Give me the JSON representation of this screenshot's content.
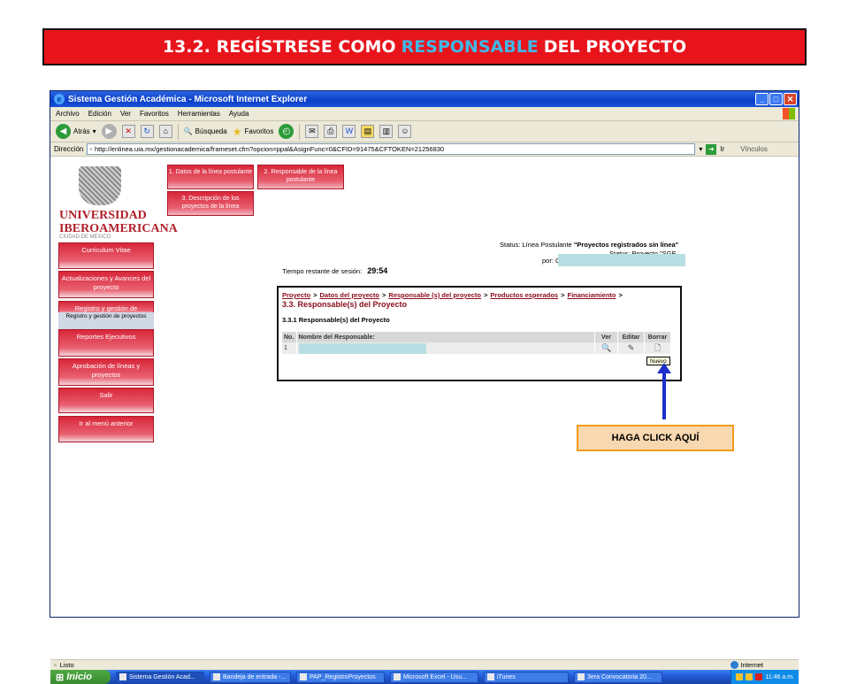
{
  "banner": {
    "prefix": "13.2. REGÍSTRESE COMO",
    "highlight": "RESPONSABLE",
    "suffix": "DEL PROYECTO"
  },
  "window": {
    "title": "Sistema Gestión Académica - Microsoft Internet Explorer",
    "menu": [
      "Archivo",
      "Edición",
      "Ver",
      "Favoritos",
      "Herramientas",
      "Ayuda"
    ],
    "toolbar": {
      "back": "Atrás",
      "search": "Búsqueda",
      "favorites": "Favoritos"
    },
    "address_label": "Dirección",
    "url": "http://enlinea.uia.mx/gestionacademica/frameset.cfm?opcion=ppal&AsignFunc=0&CFID=91475&CFTOKEN=21256830",
    "go_label": "Ir",
    "links_label": "Vínculos",
    "status_left": "Listo",
    "status_zone": "Internet"
  },
  "logo": {
    "line1": "UNIVERSIDAD",
    "line2": "IBEROAMERICANA",
    "line3": "CIUDAD DE MÉXICO"
  },
  "sidebar": [
    {
      "label": "Curriculum Vitae"
    },
    {
      "label": "Actualizaciones y Avances del proyecto"
    },
    {
      "label": "Registro y gestión de"
    },
    {
      "label": "Reportes Ejecutivos"
    },
    {
      "label": "Aprobación de líneas y proyectos"
    },
    {
      "label": "Salir"
    },
    {
      "label": "Ir al menú anterior"
    }
  ],
  "sidebar_submenu": "Registro y gestión de proyectos",
  "top_buttons": [
    {
      "label": "1. Datos de la línea postulante"
    },
    {
      "label": "2. Responsable de la línea postulante"
    },
    {
      "label": "3. Descripción de los proyectos de la línea"
    }
  ],
  "status": {
    "prefix": "Status: Línea Postulante",
    "value": "\"Proyectos registrados sin línea\"",
    "line2": "Status: Proyecto \"SGE",
    "por": "por: C"
  },
  "session": {
    "label": "Tiempo restante de sesión:",
    "time": "29:54"
  },
  "panel": {
    "crumbs": [
      "Proyecto",
      "Datos del proyecto",
      "Responsable (s) del proyecto",
      "Productos esperados",
      "Financiamiento"
    ],
    "title": "3.3. Responsable(s) del Proyecto",
    "subtitle": "3.3.1 Responsable(s) del Proyecto",
    "columns": [
      "No.",
      "Nombre del Responsable:",
      "Ver",
      "Editar",
      "Borrar"
    ],
    "rows": [
      {
        "no": "1",
        "name": ""
      }
    ],
    "tooltip": "Nuevo"
  },
  "taskbar": {
    "start": "Inicio",
    "tasks": [
      "Sistema Gestión Acad...",
      "Bandeja de entrada -...",
      "PAP_RegistroProyectos",
      "Microsoft Excel - Usu...",
      "iTunes",
      "3era Convocatoria 20..."
    ],
    "clock": "11:46 a.m."
  },
  "callout": "HAGA CLICK AQUÍ"
}
